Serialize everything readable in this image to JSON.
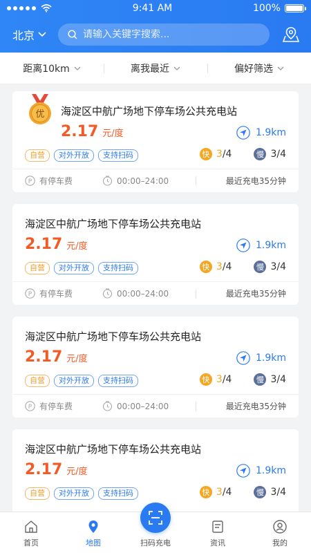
{
  "status_bar": {
    "time": "9:41 AM",
    "battery": "100%"
  },
  "header": {
    "city": "北京",
    "search_placeholder": "请输入关键字搜索..."
  },
  "filters": [
    {
      "label": "距离10km"
    },
    {
      "label": "离我最近"
    },
    {
      "label": "偏好筛选"
    }
  ],
  "featured_badge": "优",
  "stations": [
    {
      "name": "海淀区中航广场地下停车场公共充电站",
      "price": "2.17",
      "unit": "元/度",
      "distance": "1.9km",
      "tags": [
        "自营",
        "对外开放",
        "支持扫码"
      ],
      "fast_label": "快",
      "fast_count": "3",
      "fast_total": "/4",
      "slow_label": "慢",
      "slow_count": "3/4",
      "parking": "有停车费",
      "hours": "00:00–24:00",
      "recent": "最近充电35分钟"
    },
    {
      "name": "海淀区中航广场地下停车场公共充电站",
      "price": "2.17",
      "unit": "元/度",
      "distance": "1.9km",
      "tags": [
        "自营",
        "对外开放",
        "支持扫码"
      ],
      "fast_label": "快",
      "fast_count": "3",
      "fast_total": "/4",
      "slow_label": "慢",
      "slow_count": "3/4",
      "parking": "有停车费",
      "hours": "00:00–24:00",
      "recent": "最近充电35分钟"
    },
    {
      "name": "海淀区中航广场地下停车场公共充电站",
      "price": "2.17",
      "unit": "元/度",
      "distance": "1.9km",
      "tags": [
        "自营",
        "对外开放",
        "支持扫码"
      ],
      "fast_label": "快",
      "fast_count": "3",
      "fast_total": "/4",
      "slow_label": "慢",
      "slow_count": "3/4",
      "parking": "有停车费",
      "hours": "00:00–24:00",
      "recent": "最近充电35分钟"
    },
    {
      "name": "海淀区中航广场地下停车场公共充电站",
      "price": "2.17",
      "unit": "元/度",
      "distance": "1.9km",
      "tags": [
        "自营",
        "对外开放",
        "支持扫码"
      ],
      "fast_label": "快",
      "fast_count": "3",
      "fast_total": "/4",
      "slow_label": "慢",
      "slow_count": "3/4"
    }
  ],
  "tabs": [
    {
      "label": "首页"
    },
    {
      "label": "地图"
    },
    {
      "label": "扫码充电"
    },
    {
      "label": "资讯"
    },
    {
      "label": "我的"
    }
  ],
  "colors": {
    "primary": "#2a7af1",
    "price": "#f25a26",
    "fast": "#f5a623",
    "slow": "#5a6f99"
  }
}
